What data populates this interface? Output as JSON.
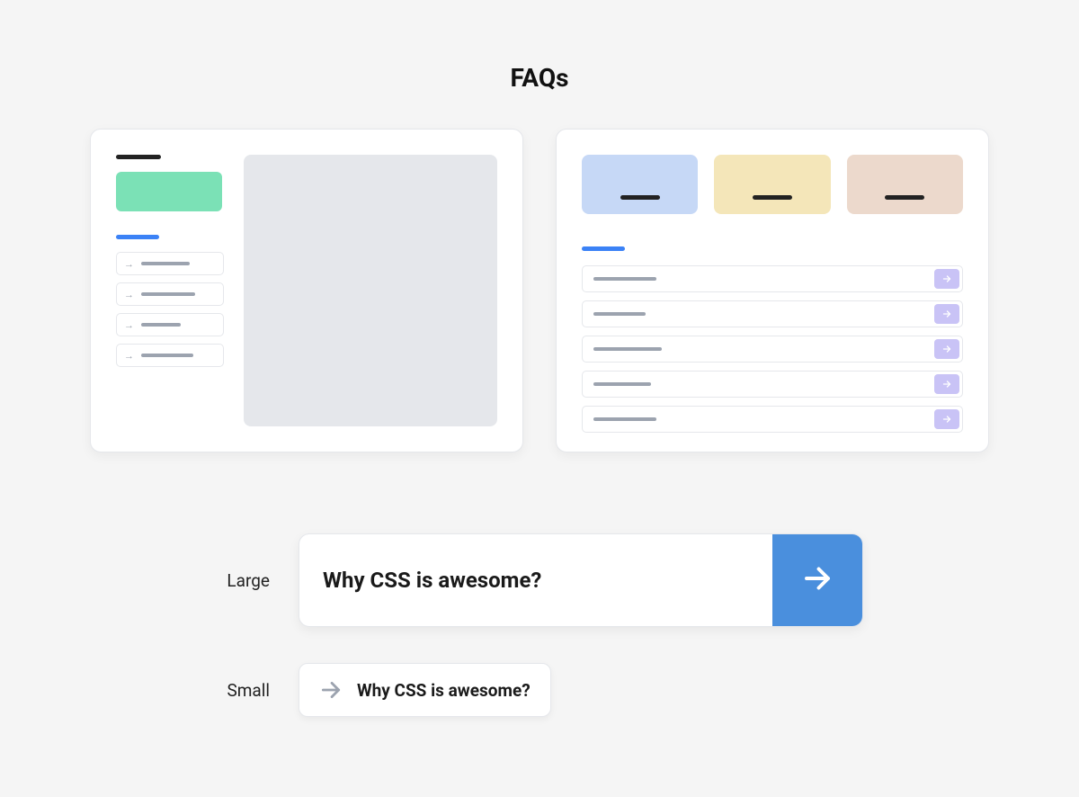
{
  "title": "FAQs",
  "card1": {
    "sidebar_items": [
      {
        "line_width": 54
      },
      {
        "line_width": 60
      },
      {
        "line_width": 44
      },
      {
        "line_width": 58
      }
    ]
  },
  "card2": {
    "tiles": [
      {
        "color": "blue"
      },
      {
        "color": "yellow"
      },
      {
        "color": "tan"
      }
    ],
    "items": [
      {
        "line_width": 70
      },
      {
        "line_width": 58
      },
      {
        "line_width": 76
      },
      {
        "line_width": 64
      },
      {
        "line_width": 70
      }
    ]
  },
  "examples": {
    "large": {
      "label": "Large",
      "question": "Why CSS is awesome?"
    },
    "small": {
      "label": "Small",
      "question": "Why CSS is awesome?"
    }
  }
}
